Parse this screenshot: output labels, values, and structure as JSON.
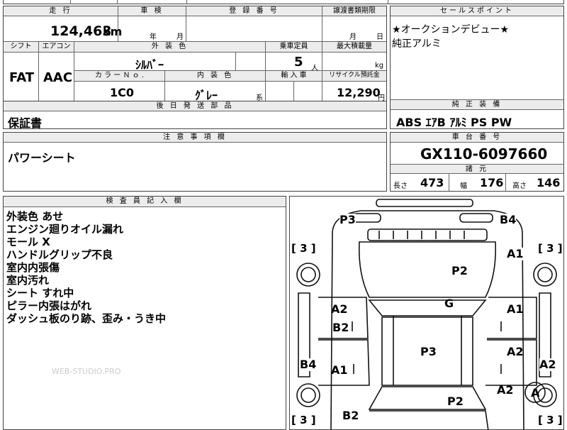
{
  "sheet": {
    "top_cut": [
      "走行",
      "車検",
      "登録番号",
      "譲渡書類期限"
    ],
    "mileage": {
      "label": "走 行",
      "value": "124,463",
      "unit": "km"
    },
    "shaken": {
      "label": "車 検",
      "year": "年",
      "month": "月"
    },
    "reg_no": {
      "label": "登 録 番 号",
      "value": ""
    },
    "transfer": {
      "label": "譲渡書類期限",
      "month": "月",
      "day": "日"
    },
    "sales_point": {
      "label": "セールスポイント",
      "lines": [
        "★オークションデビュー★",
        "純正アルミ"
      ]
    },
    "shift": {
      "label": "シフト",
      "value": "FAT"
    },
    "aircon": {
      "label": "エアコン",
      "value": "AAC"
    },
    "exterior": {
      "label": "外 装 色",
      "value": "ｼﾙﾊﾞｰ"
    },
    "capacity": {
      "label": "乗車定員",
      "value": "5",
      "unit": "人"
    },
    "max_load": {
      "label": "最大積載量",
      "unit": "kg"
    },
    "color_no": {
      "label": "カ ラ ー Ｎ ｏ .",
      "value": "1C0"
    },
    "interior": {
      "label": "内 装 色",
      "value": "ｸﾞﾚｰ",
      "suffix": "系"
    },
    "import": {
      "label": "輸 入 車"
    },
    "recycle": {
      "label": "リサイクル預託金",
      "value": "12,290",
      "unit": "円"
    },
    "later_parts": {
      "label": "後 日 発 送 部 品",
      "value": "保証書"
    },
    "equipment": {
      "label": "純 正 装 備",
      "value": "ABS ｴｱB ｱﾙﾐ PS PW"
    },
    "notes": {
      "label": "注 意 事 項 欄",
      "value": "パワーシート"
    },
    "chassis": {
      "label": "車 台 番 号",
      "value": "GX110-6097660"
    },
    "spec": {
      "label": "諸 元",
      "length_label": "長さ",
      "length": "473",
      "width_label": "幅",
      "width": "176",
      "height_label": "高さ",
      "height": "146"
    },
    "inspector": {
      "label": "検 査 員 記 入 欄",
      "lines": [
        "外装色 あせ",
        "エンジン廻りオイル漏れ",
        "モール X",
        "ハンドルグリップ不良",
        "室内内張傷",
        "室内汚れ",
        "シート すれ中",
        "ピラー内張はがれ",
        "ダッシュ板のり跡、歪み・うき中"
      ]
    },
    "watermark": "WEB-STUDIO.PRO"
  },
  "diagram": {
    "marks": {
      "p3_top": "P3",
      "b4_top": "B4",
      "p2_upper": "P2",
      "g": "G",
      "a1_upper": "A1",
      "a2_left_upper": "A2",
      "b2_left": "B2",
      "a1_right_mid": "A1",
      "p3_center": "P3",
      "a2_right_mid": "A2",
      "b4_left": "B4",
      "a1_left_lower": "A1",
      "a2_right_edge": "A2",
      "a2_right_lower": "A2",
      "p2_lower": "P2",
      "b2_bottom": "B2",
      "a_circle": "A"
    },
    "tires": [
      "[ 3 ]",
      "[ 3 ]",
      "[ 3 ]",
      "[ 3 ]"
    ]
  }
}
